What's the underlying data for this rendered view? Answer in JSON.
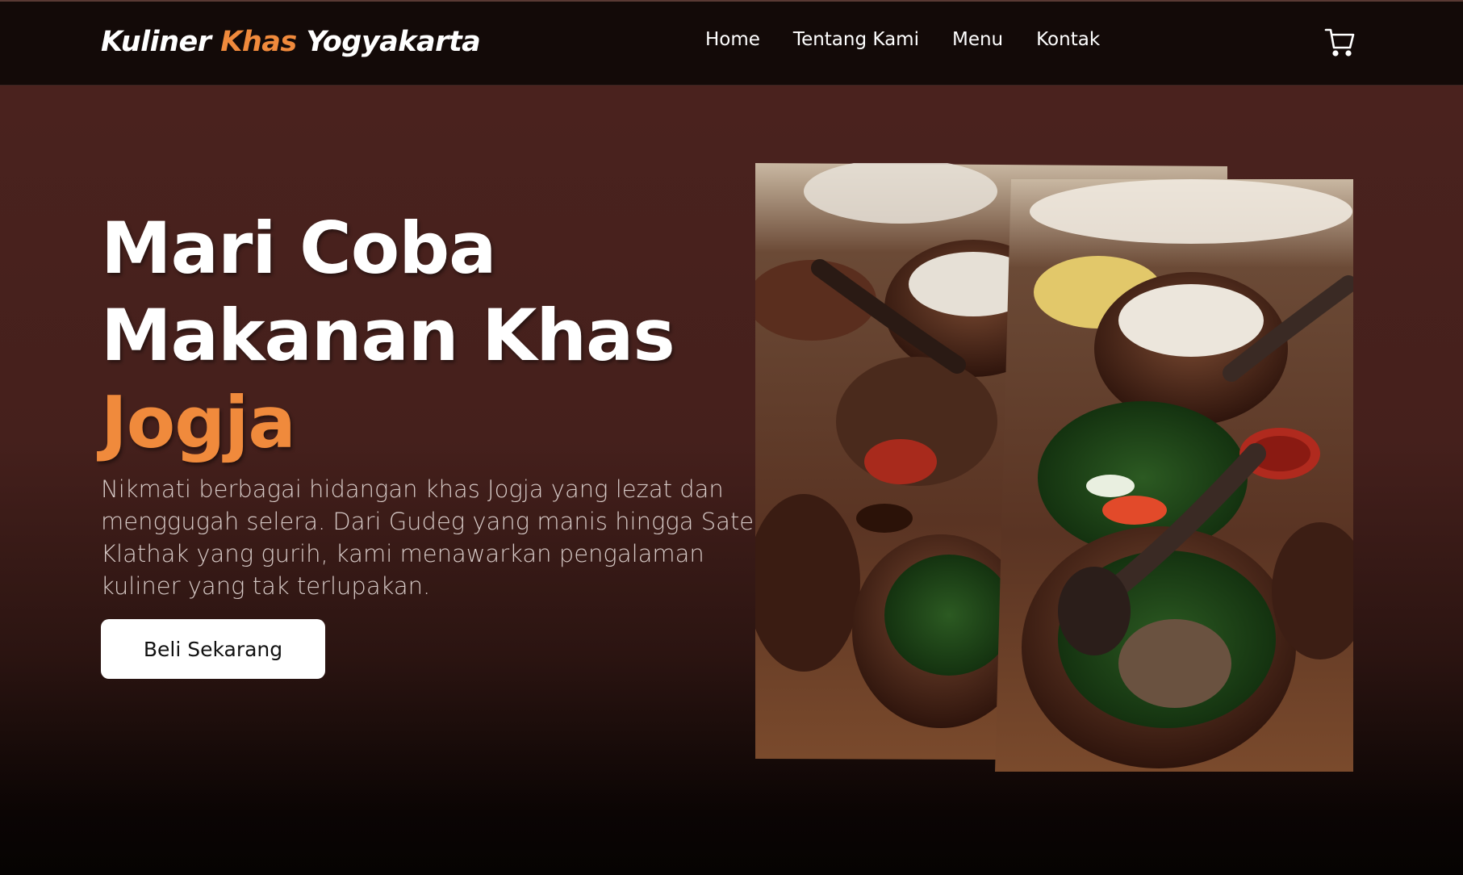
{
  "nav": {
    "logo": {
      "part1": "Kuliner ",
      "part2": "Khas",
      "part3": " Yogyakarta"
    },
    "links": [
      {
        "label": "Home"
      },
      {
        "label": "Tentang Kami"
      },
      {
        "label": "Menu"
      },
      {
        "label": "Kontak"
      }
    ],
    "cart_icon": "shopping-cart-icon"
  },
  "hero": {
    "title_line1": "Mari Coba",
    "title_line2": "Makanan Khas",
    "title_accent": "Jogja",
    "description": "Nikmati berbagai hidangan khas Jogja yang lezat dan menggugah selera. Dari Gudeg yang manis hingga Sate Klathak yang gurih, kami menawarkan pengalaman kuliner yang tak terlupakan.",
    "cta_label": "Beli Sekarang"
  },
  "colors": {
    "accent": "#f08a3c",
    "navbar_bg": "#130a08",
    "hero_bg": "#4a221e",
    "button_bg": "#ffffff"
  }
}
